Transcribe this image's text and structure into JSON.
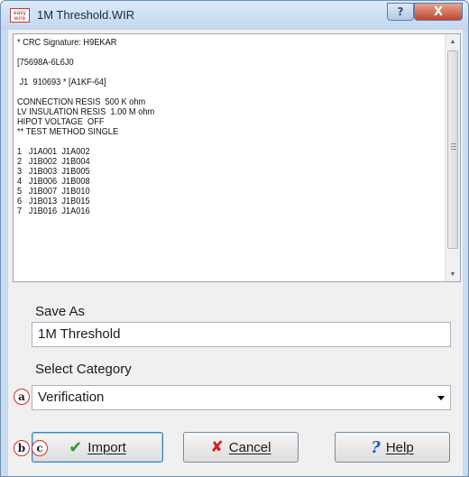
{
  "window": {
    "title": "1M Threshold.WIR",
    "app_icon_text": "easy wire",
    "help_button": "?",
    "close_button": "X"
  },
  "textbox": {
    "lines": [
      "* CRC Signature: H9EKAR",
      "",
      "[75698A-6L6J0",
      "",
      " J1  910693 * [A1KF-64]",
      "",
      "CONNECTION RESIS  500 K ohm",
      "LV INSULATION RESIS  1.00 M ohm",
      "HIPOT VOLTAGE  OFF",
      "** TEST METHOD SINGLE",
      "",
      "1   J1A001  J1A002",
      "2   J1B002  J1B004",
      "3   J1B003  J1B005",
      "4   J1B006  J1B008",
      "5   J1B007  J1B010",
      "6   J1B013  J1B015",
      "7   J1B016  J1A016"
    ]
  },
  "form": {
    "save_as_label": "Save As",
    "save_as_value": "1M Threshold",
    "category_label": "Select Category",
    "category_value": "Verification"
  },
  "callouts": {
    "a": "a",
    "b": "b",
    "c": "c"
  },
  "buttons": {
    "import_label": "Import",
    "cancel_label": "Cancel",
    "help_label": "Help",
    "help_icon": "?",
    "cancel_icon": "✘",
    "import_icon": "✔"
  },
  "icons": [
    "check-icon",
    "x-icon",
    "question-icon",
    "chevron-down-icon",
    "app-icon"
  ],
  "colors": {
    "close": "#c2462c",
    "callout": "#d42b2b",
    "check": "#2e9a2e",
    "cross": "#d11c1c",
    "help": "#1f5bc8"
  }
}
